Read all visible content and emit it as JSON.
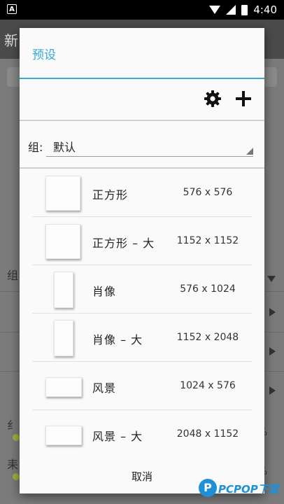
{
  "status_bar": {
    "time": "4:40",
    "notification_icon": "A"
  },
  "background_app": {
    "toolbar_char": "新",
    "group_char": "组",
    "row_chars": [
      "纟",
      "耒"
    ],
    "pct": [
      "%",
      "%"
    ]
  },
  "dialog": {
    "title": "预设",
    "toolbar": {
      "settings_icon": "gear-icon",
      "add_icon": "plus-icon"
    },
    "group": {
      "label": "组:",
      "selected": "默认"
    },
    "presets": [
      {
        "name": "正方形",
        "size": "576  x  576",
        "shape": "square"
      },
      {
        "name": "正方形 – 大",
        "size": "1152  x  1152",
        "shape": "square"
      },
      {
        "name": "肖像",
        "size": "576  x  1024",
        "shape": "portrait"
      },
      {
        "name": "肖像 – 大",
        "size": "1152  x  2048",
        "shape": "portrait"
      },
      {
        "name": "风景",
        "size": "1024  x  576",
        "shape": "landscape"
      },
      {
        "name": "风景 – 大",
        "size": "2048  x  1152",
        "shape": "landscape"
      }
    ],
    "cancel_label": "取消"
  },
  "watermark": {
    "logo": "P",
    "text": "PCPOP下载"
  },
  "colors": {
    "accent": "#33a9d6",
    "watermark": "#1e8fd8"
  }
}
